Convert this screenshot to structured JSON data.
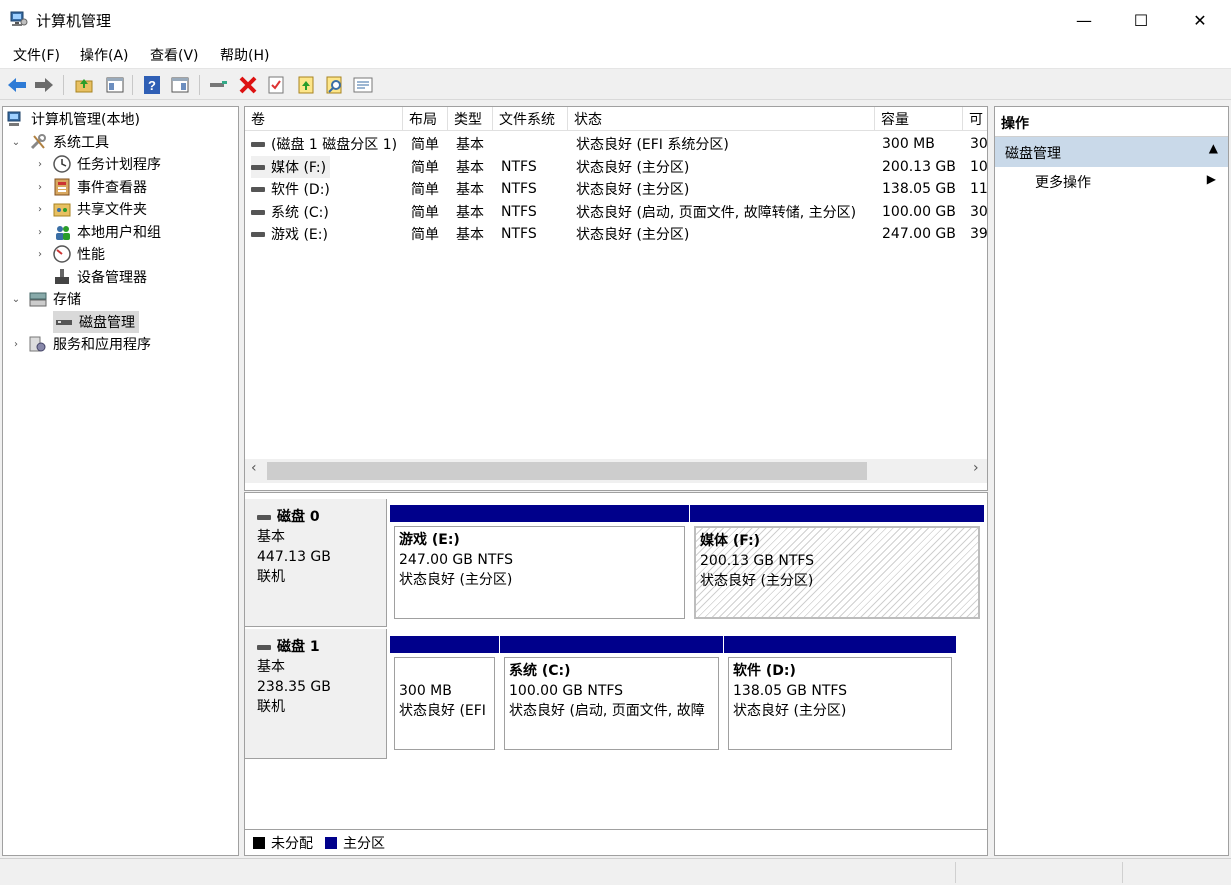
{
  "window": {
    "title": "计算机管理",
    "controls": {
      "minimize": "—",
      "maximize": "☐",
      "close": "✕"
    }
  },
  "menu": [
    "文件(F)",
    "操作(A)",
    "查看(V)",
    "帮助(H)"
  ],
  "toolbar": {
    "icons": [
      "back-icon",
      "forward-icon",
      "up-folder-icon",
      "show-tree-icon",
      "help-icon",
      "show-pane-icon",
      "connect-icon",
      "delete-icon",
      "properties-icon",
      "open-icon",
      "search-icon",
      "list-icon"
    ]
  },
  "tree": {
    "root": "计算机管理(本地)",
    "system_tools": "系统工具",
    "task_scheduler": "任务计划程序",
    "event_viewer": "事件查看器",
    "shared_folders": "共享文件夹",
    "local_users": "本地用户和组",
    "performance": "性能",
    "device_manager": "设备管理器",
    "storage": "存储",
    "disk_management": "磁盘管理",
    "services": "服务和应用程序"
  },
  "volume_list": {
    "columns": [
      "卷",
      "布局",
      "类型",
      "文件系统",
      "状态",
      "容量",
      "可"
    ],
    "rows": [
      {
        "volume": "(磁盘 1 磁盘分区 1)",
        "layout": "简单",
        "type": "基本",
        "fs": "",
        "status": "状态良好 (EFI 系统分区)",
        "capacity": "300 MB",
        "free": "30"
      },
      {
        "volume": "媒体 (F:)",
        "layout": "简单",
        "type": "基本",
        "fs": "NTFS",
        "status": "状态良好 (主分区)",
        "capacity": "200.13 GB",
        "free": "10"
      },
      {
        "volume": "软件 (D:)",
        "layout": "简单",
        "type": "基本",
        "fs": "NTFS",
        "status": "状态良好 (主分区)",
        "capacity": "138.05 GB",
        "free": "11"
      },
      {
        "volume": "系统 (C:)",
        "layout": "简单",
        "type": "基本",
        "fs": "NTFS",
        "status": "状态良好 (启动, 页面文件, 故障转储, 主分区)",
        "capacity": "100.00 GB",
        "free": "30"
      },
      {
        "volume": "游戏 (E:)",
        "layout": "简单",
        "type": "基本",
        "fs": "NTFS",
        "status": "状态良好 (主分区)",
        "capacity": "247.00 GB",
        "free": "39"
      }
    ],
    "scroll_left": "‹",
    "scroll_right": "›"
  },
  "disks": [
    {
      "name": "磁盘 0",
      "type": "基本",
      "size": "447.13 GB",
      "state": "联机",
      "partitions": [
        {
          "label": "游戏  (E:)",
          "size": "247.00 GB NTFS",
          "status": "状态良好 (主分区)"
        },
        {
          "label": "媒体  (F:)",
          "size": "200.13 GB NTFS",
          "status": "状态良好 (主分区)"
        }
      ]
    },
    {
      "name": "磁盘 1",
      "type": "基本",
      "size": "238.35 GB",
      "state": "联机",
      "partitions": [
        {
          "label": "",
          "size": "300 MB",
          "status": "状态良好 (EFI"
        },
        {
          "label": "系统  (C:)",
          "size": "100.00 GB NTFS",
          "status": "状态良好 (启动, 页面文件, 故障"
        },
        {
          "label": "软件  (D:)",
          "size": "138.05 GB NTFS",
          "status": "状态良好 (主分区)"
        }
      ]
    }
  ],
  "legend": {
    "unallocated": "未分配",
    "primary": "主分区",
    "unallocated_color": "#000000",
    "primary_color": "#00008b"
  },
  "actions": {
    "header": "操作",
    "selected": "磁盘管理",
    "more": "更多操作"
  },
  "colors": {
    "partition_bar": "#00008b",
    "selection": "#c9d9e9"
  }
}
